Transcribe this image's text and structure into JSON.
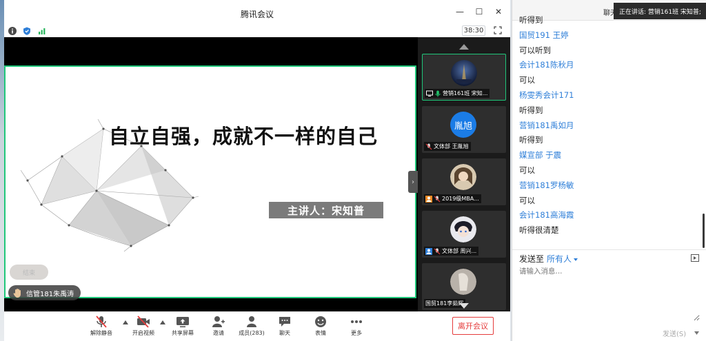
{
  "window": {
    "title": "腾讯会议",
    "timer": "38:30"
  },
  "slide": {
    "title": "自立自强，成就不一样的自己",
    "speaker": "主讲人：宋知普"
  },
  "overlays": {
    "hand_pill_text": "结束",
    "raised_hand_name": "信管181朱禹涛"
  },
  "gallery": [
    {
      "label": "营销161班 宋知...",
      "avatar_text": "",
      "active": true
    },
    {
      "label": "文体部 王胤旭",
      "avatar_text": "胤旭",
      "active": false
    },
    {
      "label": "2019级MBA...",
      "avatar_text": "",
      "active": false
    },
    {
      "label": "文体部 周兴...",
      "avatar_text": "",
      "active": false
    },
    {
      "label": "国贸181李茹辉",
      "avatar_text": "",
      "active": false
    }
  ],
  "toolbar": {
    "unmute": "解除静音",
    "start_video": "开启视频",
    "share_screen": "共享屏幕",
    "invite": "邀请",
    "members": "成员(283)",
    "chat": "聊天",
    "emoji": "表情",
    "more": "更多",
    "leave": "离开会议"
  },
  "chat": {
    "title": "聊天",
    "speaking_banner": "正在讲话: 营销161班 宋知普;",
    "messages": [
      {
        "kind": "text",
        "value": "听得到"
      },
      {
        "kind": "sender",
        "value": "国贸191 王婷"
      },
      {
        "kind": "text",
        "value": "可以听到"
      },
      {
        "kind": "sender",
        "value": "会计181陈秋月"
      },
      {
        "kind": "text",
        "value": "可以"
      },
      {
        "kind": "sender",
        "value": "杨雯秀会计171"
      },
      {
        "kind": "text",
        "value": "听得到"
      },
      {
        "kind": "sender",
        "value": "营销181禹如月"
      },
      {
        "kind": "text",
        "value": "听得到"
      },
      {
        "kind": "sender",
        "value": "媒宣部 于震"
      },
      {
        "kind": "text",
        "value": "可以"
      },
      {
        "kind": "sender",
        "value": "营销181罗杨敏"
      },
      {
        "kind": "text",
        "value": "可以"
      },
      {
        "kind": "sender",
        "value": "会计181高海霞"
      },
      {
        "kind": "text",
        "value": "听得很清楚"
      }
    ],
    "send_to_label": "发送至",
    "send_to_target": "所有人",
    "input_placeholder": "请输入消息...",
    "send_button": "发送(S)"
  },
  "colors": {
    "accent_green": "#1fc77a",
    "link_blue": "#2f7fd8",
    "leave_red": "#e53b3b"
  },
  "icons": [
    "info-icon",
    "shield-icon",
    "signal-icon",
    "fullscreen-icon",
    "mic-muted-icon",
    "video-off-icon",
    "share-screen-icon",
    "invite-icon",
    "members-icon",
    "chat-icon",
    "emoji-icon",
    "more-icon"
  ]
}
